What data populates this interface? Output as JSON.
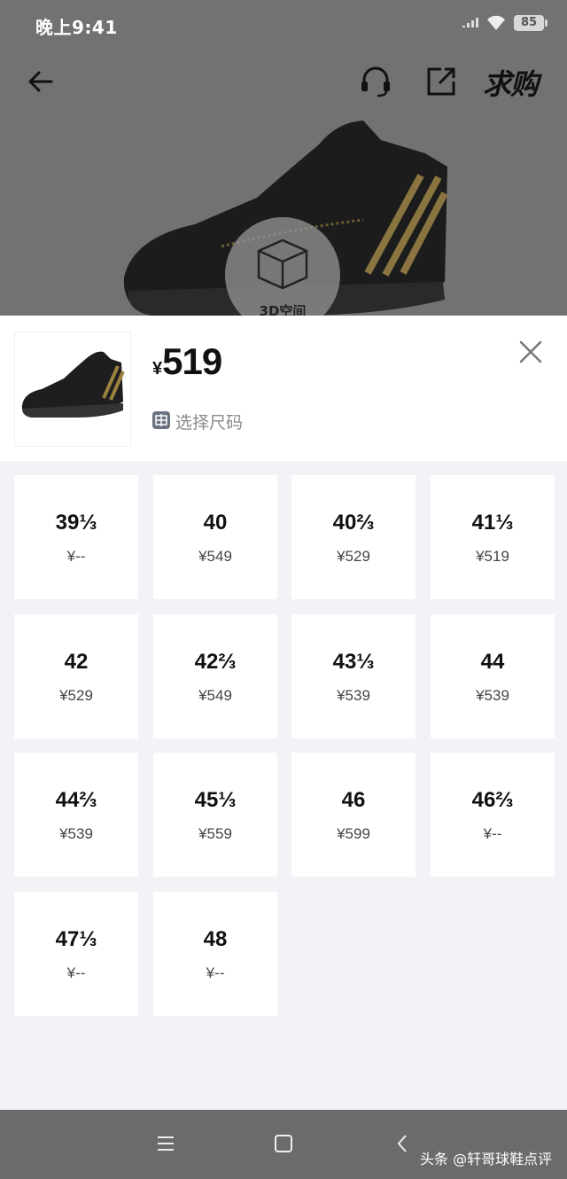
{
  "status_bar": {
    "time": "晚上9:41",
    "battery": "85",
    "icons": [
      "signal-icon",
      "wifi-icon",
      "battery-icon"
    ]
  },
  "nav": {
    "icons": [
      "back-arrow-icon",
      "headset-support-icon",
      "share-icon"
    ],
    "wanted_label": "求购"
  },
  "hero": {
    "badge_label": "3D空间",
    "badge_icon": "cube-3d-icon"
  },
  "sheet": {
    "currency": "¥",
    "price": "519",
    "select_size_label": "选择尺码",
    "close_icon": "close-icon",
    "sizes": [
      {
        "size": "39⅓",
        "price": "¥--"
      },
      {
        "size": "40",
        "price": "¥549"
      },
      {
        "size": "40⅔",
        "price": "¥529"
      },
      {
        "size": "41⅓",
        "price": "¥519"
      },
      {
        "size": "42",
        "price": "¥529"
      },
      {
        "size": "42⅔",
        "price": "¥549"
      },
      {
        "size": "43⅓",
        "price": "¥539"
      },
      {
        "size": "44",
        "price": "¥539"
      },
      {
        "size": "44⅔",
        "price": "¥539"
      },
      {
        "size": "45⅓",
        "price": "¥559"
      },
      {
        "size": "46",
        "price": "¥599"
      },
      {
        "size": "46⅔",
        "price": "¥--"
      },
      {
        "size": "47⅓",
        "price": "¥--"
      },
      {
        "size": "48",
        "price": "¥--"
      }
    ]
  },
  "system_nav": {
    "icons": [
      "menu-icon",
      "home-icon",
      "back-icon"
    ],
    "watermark": "头条 @轩哥球鞋点评"
  },
  "colors": {
    "sheet_bg": "#f2f2f7",
    "cell_bg": "#ffffff",
    "dim_overlay": "#727272",
    "shoe_accent": "#b8963a"
  }
}
